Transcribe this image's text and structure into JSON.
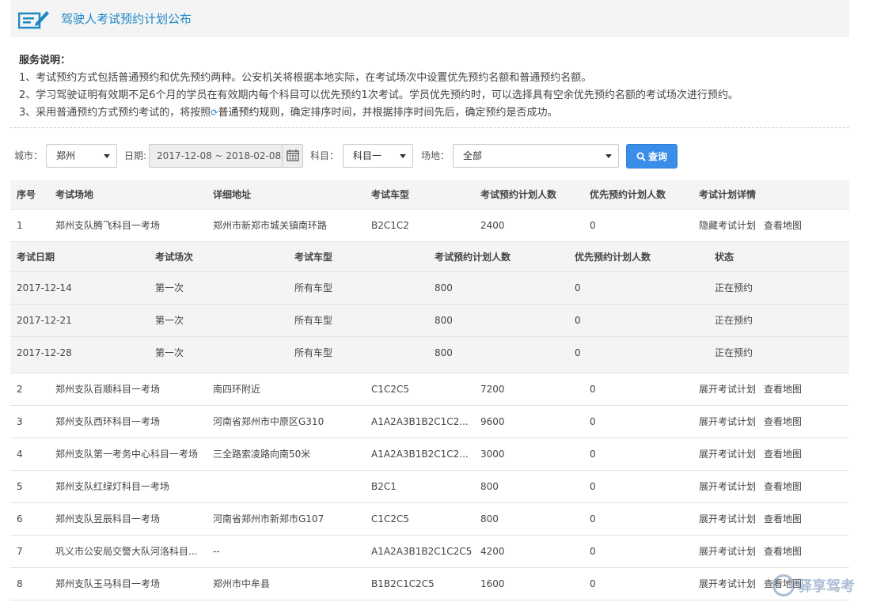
{
  "header": {
    "title": "驾驶人考试预约计划公布"
  },
  "service": {
    "title": "服务说明：",
    "line1": "1、考试预约方式包括普通预约和优先预约两种。公安机关将根据本地实际，在考试场次中设置优先预约名额和普通预约名额。",
    "line2": "2、学习驾驶证明有效期不足6个月的学员在有效期内每个科目可以优先预约1次考试。学员优先预约时，可以选择具有空余优先预约名额的考试场次进行预约。",
    "line3_pre": "3、采用普通预约方式预约考试的，将按照",
    "line3_link": "普通预约规则",
    "line3_post": "，确定排序时间，并根据排序时间先后，确定预约是否成功。"
  },
  "filters": {
    "city_label": "城市：",
    "city_value": "郑州",
    "date_label": "日期:",
    "date_value": "2017-12-08 ~ 2018-02-08",
    "subject_label": "科目：",
    "subject_value": "科目一",
    "site_label": "场地：",
    "site_value": "全部",
    "search_label": "查询"
  },
  "table": {
    "headers": [
      "序号",
      "考试场地",
      "详细地址",
      "考试车型",
      "考试预约计划人数",
      "优先预约计划人数",
      "考试计划详情"
    ],
    "map_label": "查看地图",
    "rows": [
      {
        "no": "1",
        "site": "郑州支队腾飞科目一考场",
        "addr": "郑州市新郑市城关镇南环路",
        "car": "B2C1C2",
        "plan": "2400",
        "prio": "0",
        "action": "隐藏考试计划"
      },
      {
        "no": "2",
        "site": "郑州支队百顺科目一考场",
        "addr": "南四环附近",
        "car": "C1C2C5",
        "plan": "7200",
        "prio": "0",
        "action": "展开考试计划"
      },
      {
        "no": "3",
        "site": "郑州支队西环科目一考场",
        "addr": "河南省郑州市中原区G310",
        "car": "A1A2A3B1B2C1C2...",
        "plan": "9600",
        "prio": "0",
        "action": "展开考试计划"
      },
      {
        "no": "4",
        "site": "郑州支队第一考务中心科目一考场",
        "addr": "三全路索凌路向南50米",
        "car": "A1A2A3B1B2C1C2...",
        "plan": "3000",
        "prio": "0",
        "action": "展开考试计划"
      },
      {
        "no": "5",
        "site": "郑州支队红绿灯科目一考场",
        "addr": "",
        "car": "B2C1",
        "plan": "800",
        "prio": "0",
        "action": "展开考试计划"
      },
      {
        "no": "6",
        "site": "郑州支队昱辰科目一考场",
        "addr": "河南省郑州市新郑市G107",
        "car": "C1C2C5",
        "plan": "800",
        "prio": "0",
        "action": "展开考试计划"
      },
      {
        "no": "7",
        "site": "巩义市公安局交警大队河洛科目...",
        "addr": "--",
        "car": "A1A2A3B1B2C1C2C5",
        "plan": "4200",
        "prio": "0",
        "action": "展开考试计划"
      },
      {
        "no": "8",
        "site": "郑州支队玉马科目一考场",
        "addr": "郑州市中牟县",
        "car": "B1B2C1C2C5",
        "plan": "1600",
        "prio": "0",
        "action": "展开考试计划"
      }
    ],
    "sub_headers": [
      "考试日期",
      "考试场次",
      "考试车型",
      "考试预约计划人数",
      "优先预约计划人数",
      "状态"
    ],
    "sub_rows": [
      {
        "date": "2017-12-14",
        "session": "第一次",
        "car": "所有车型",
        "plan": "800",
        "prio": "0",
        "status": "正在预约"
      },
      {
        "date": "2017-12-21",
        "session": "第一次",
        "car": "所有车型",
        "plan": "800",
        "prio": "0",
        "status": "正在预约"
      },
      {
        "date": "2017-12-28",
        "session": "第一次",
        "car": "所有车型",
        "plan": "800",
        "prio": "0",
        "status": "正在预约"
      }
    ]
  },
  "watermark": {
    "text": "驿享驾考"
  },
  "colors": {
    "accent": "#1e88c7",
    "button": "#3a8de8"
  }
}
